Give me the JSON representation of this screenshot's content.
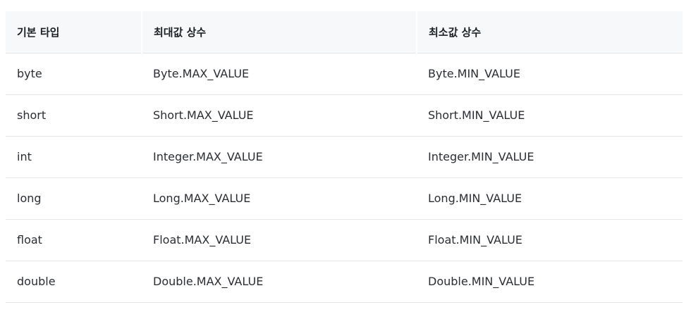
{
  "table": {
    "headers": [
      "기본 타입",
      "최대값 상수",
      "최소값 상수"
    ],
    "rows": [
      [
        "byte",
        "Byte.MAX_VALUE",
        "Byte.MIN_VALUE"
      ],
      [
        "short",
        "Short.MAX_VALUE",
        "Short.MIN_VALUE"
      ],
      [
        "int",
        "Integer.MAX_VALUE",
        "Integer.MIN_VALUE"
      ],
      [
        "long",
        "Long.MAX_VALUE",
        "Long.MIN_VALUE"
      ],
      [
        "float",
        "Float.MAX_VALUE",
        "Float.MIN_VALUE"
      ],
      [
        "double",
        "Double.MAX_VALUE",
        "Double.MIN_VALUE"
      ]
    ]
  },
  "colors": {
    "header_bg": "#f7f8f9",
    "divider": "#e4e6e8",
    "text": "#2a2e33"
  }
}
